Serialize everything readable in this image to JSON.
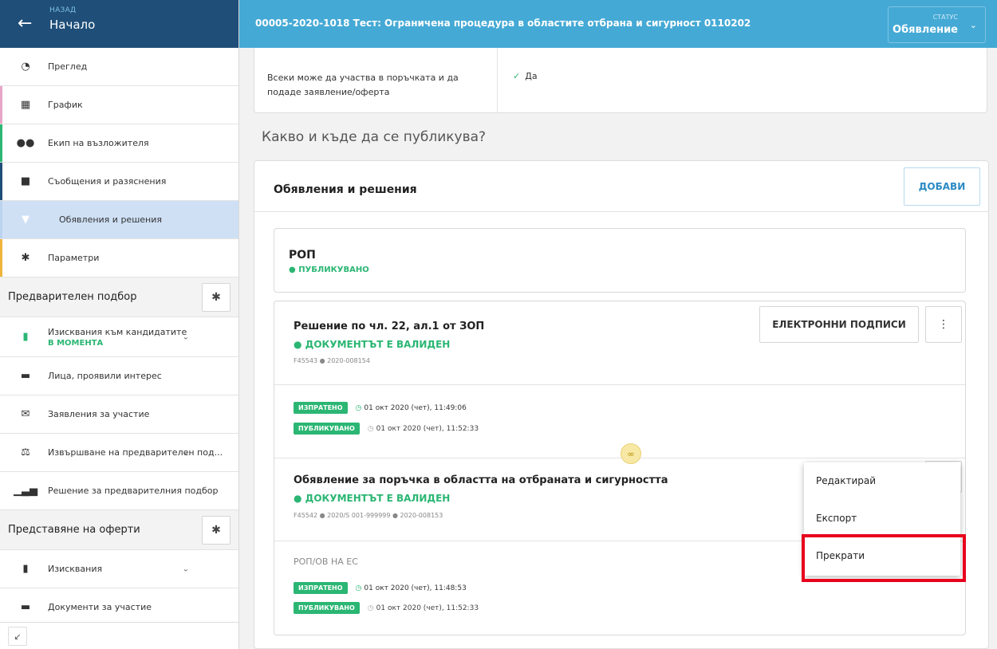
{
  "sidebar": {
    "back_label": "НАЗАД",
    "back_title": "Начало",
    "items": [
      {
        "label": "Преглед",
        "icon": "gauge-icon",
        "accent": ""
      },
      {
        "label": "График",
        "icon": "calendar-icon",
        "accent": "#e7a6c8"
      },
      {
        "label": "Екип на възложителя",
        "icon": "people-icon",
        "accent": "#2bb673"
      },
      {
        "label": "Съобщения и разяснения",
        "icon": "message-icon",
        "accent": "#1f4e79"
      },
      {
        "label": "Обявления и решения",
        "icon": "pin-icon",
        "accent": "",
        "active": true
      },
      {
        "label": "Параметри",
        "icon": "gear-icon",
        "accent": "#f0b43c"
      }
    ],
    "section1": {
      "title": "Предварителен подбор",
      "items": [
        {
          "label": "Изисквания към кандидатите",
          "status": "В МОМЕНТА"
        },
        {
          "label": "Лица, проявили интерес"
        },
        {
          "label": "Заявления за участие"
        },
        {
          "label": "Извършване на предварителен под..."
        },
        {
          "label": "Решение за предварителния подбор"
        }
      ]
    },
    "section2": {
      "title": "Представяне на оферти",
      "items": [
        {
          "label": "Изисквания"
        },
        {
          "label": "Документи за участие"
        }
      ]
    }
  },
  "topbar": {
    "procedure_title": "00005-2020-1018  Тест: Ограничена процедура в областите отбрана и сигурност 0110202",
    "status_label": "СТАТУС",
    "status_value": "Обявление"
  },
  "main": {
    "info_label": "Всеки може да участва в поръчката и да подаде заявление/оферта",
    "info_value": "Да",
    "section_heading": "Какво и къде да се публикува?",
    "panel_title": "Обявления и решения",
    "add_label": "ДОБАВИ",
    "rop": {
      "title": "РОП",
      "status": "● ПУБЛИКУВАНО"
    },
    "decision": {
      "title": "Решение по чл. 22, ал.1 от ЗОП",
      "status": "● ДОКУМЕНТЪТ Е ВАЛИДЕН",
      "meta": "F45543  ●  2020-008154",
      "esign_label": "ЕЛЕКТРОННИ ПОДПИСИ",
      "events": [
        {
          "tag": "ИЗПРАТЕНО",
          "time": "01 окт 2020 (чет), 11:49:06"
        },
        {
          "tag": "ПУБЛИКУВАНО",
          "time": "01 окт 2020 (чет), 11:52:33"
        }
      ]
    },
    "notice": {
      "title": "Обявление за поръчка в областта на отбраната и сигурността",
      "status": "● ДОКУМЕНТЪТ Е ВАЛИДЕН",
      "meta": "F45542  ●  2020/S 001-999999  ●  2020-008153",
      "sub_label": "РОП/ОВ НА ЕС",
      "events": [
        {
          "tag": "ИЗПРАТЕНО",
          "time": "01 окт 2020 (чет), 11:48:53"
        },
        {
          "tag": "ПУБЛИКУВАНО",
          "time": "01 окт 2020 (чет), 11:52:33"
        }
      ]
    }
  },
  "context_menu": {
    "items": [
      "Редактирай",
      "Експорт",
      "Прекрати"
    ]
  },
  "colors": {
    "sidebar_header": "#1f4e79",
    "topbar": "#45a9d5",
    "success": "#2bb673",
    "highlight": "#e8001c"
  }
}
